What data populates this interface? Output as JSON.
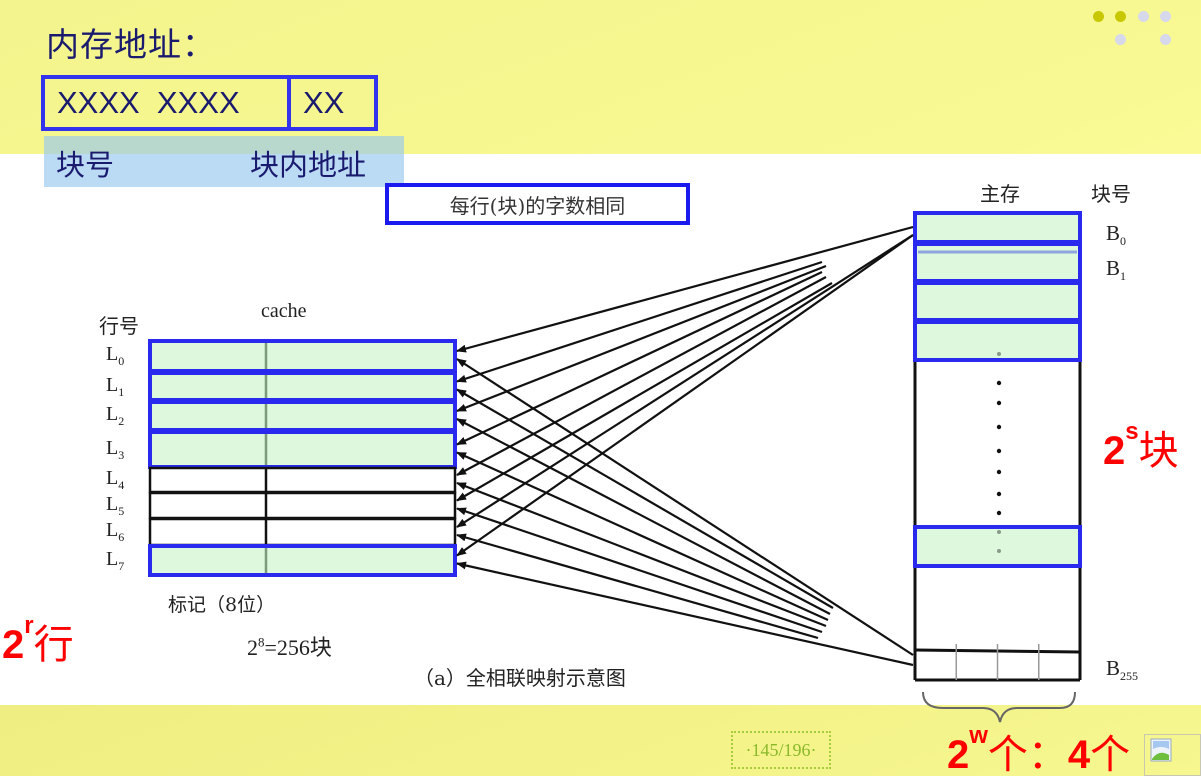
{
  "slide": {
    "title": "内存地址：",
    "address_fields": [
      {
        "value": "XXXX  XXXX",
        "label": "块号"
      },
      {
        "value": "XX",
        "label": "块内地址"
      }
    ],
    "note": "每行(块)的字数相同",
    "page_indicator": "·145/196·",
    "nav_dots": [
      {
        "active": true
      },
      {
        "active": true
      },
      {
        "active": false
      },
      {
        "active": false
      },
      {
        "active": false
      },
      {
        "active": false
      }
    ],
    "colors": {
      "highlight_border": "#2a2aee",
      "highlight_fill": "#ddf8dd",
      "annotation_red": "#ff0000",
      "band_yellow": "#f5f58c"
    }
  },
  "cache": {
    "title": "cache",
    "row_header": "行号",
    "rows": [
      {
        "label": "L",
        "sub": "0",
        "highlighted": true
      },
      {
        "label": "L",
        "sub": "1",
        "highlighted": true
      },
      {
        "label": "L",
        "sub": "2",
        "highlighted": true
      },
      {
        "label": "L",
        "sub": "3",
        "highlighted": true
      },
      {
        "label": "L",
        "sub": "4",
        "highlighted": false
      },
      {
        "label": "L",
        "sub": "5",
        "highlighted": false
      },
      {
        "label": "L",
        "sub": "6",
        "highlighted": false
      },
      {
        "label": "L",
        "sub": "7",
        "highlighted": true
      }
    ],
    "tag_label": "标记（8位）",
    "tag_formula_base": "2",
    "tag_formula_exp": "8",
    "tag_formula_rest": "=256块"
  },
  "main_memory": {
    "title": "主存",
    "block_header": "块号",
    "blocks": [
      {
        "label": "B",
        "sub": "0"
      },
      {
        "label": "B",
        "sub": "1"
      },
      {
        "label": "B",
        "sub": "255"
      }
    ],
    "words_per_block": 4
  },
  "annotations": {
    "rows": {
      "base": "2",
      "exp": "r",
      "unit": "行"
    },
    "blocks": {
      "base": "2",
      "exp": "s",
      "unit": "块"
    },
    "words": {
      "base": "2",
      "exp": "w",
      "unit": "个：",
      "value": "4",
      "value_unit": "个"
    }
  },
  "caption": "（a）全相联映射示意图"
}
